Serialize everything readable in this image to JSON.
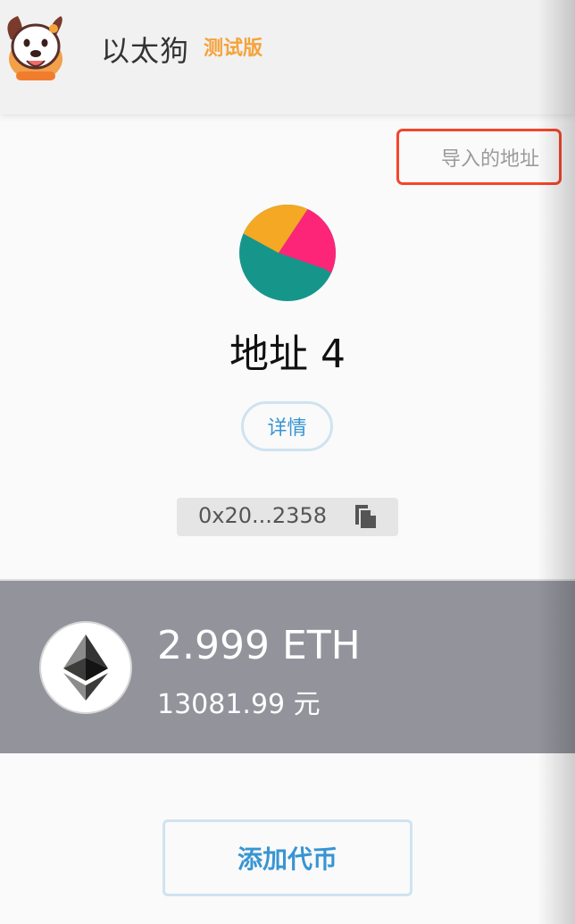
{
  "header": {
    "app_title": "以太狗",
    "badge": "测试版"
  },
  "account": {
    "imported_tag": "导入的地址",
    "name": "地址 4",
    "details_button": "详情",
    "address_short": "0x20...2358"
  },
  "balance": {
    "primary": "2.999 ETH",
    "fiat": "13081.99 元"
  },
  "actions": {
    "add_token_button": "添加代币"
  },
  "icons": {
    "logo": "dog-logo-icon",
    "avatar": "identicon-icon",
    "copy": "copy-icon",
    "token": "ethereum-icon"
  },
  "colors": {
    "accent_blue": "#3895d3",
    "badge_orange": "#f4a33a",
    "highlight_red": "#f4462b",
    "band_gray": "#93939c",
    "identicon": [
      "#16968a",
      "#f4a823",
      "#fc2577"
    ]
  }
}
